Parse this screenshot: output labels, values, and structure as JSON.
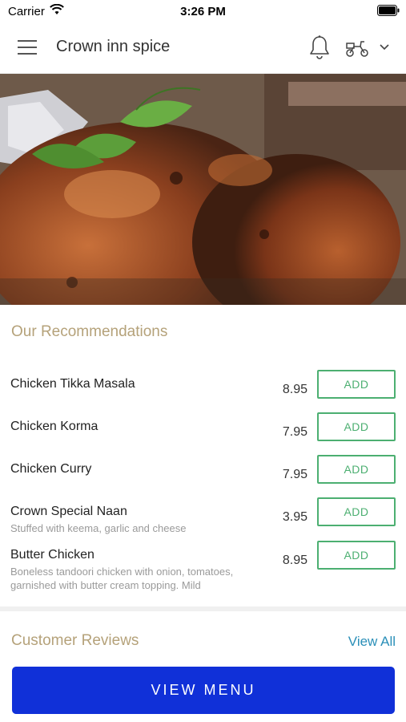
{
  "status_bar": {
    "carrier": "Carrier",
    "time": "3:26 PM"
  },
  "header": {
    "title": "Crown inn spice",
    "icons": [
      "menu-icon",
      "bell-icon",
      "scooter-icon",
      "chevron-down-icon"
    ]
  },
  "recommendations": {
    "heading": "Our Recommendations",
    "items": [
      {
        "name": "Chicken Tikka Masala",
        "description": "",
        "price": "8.95",
        "action": "ADD"
      },
      {
        "name": "Chicken Korma",
        "description": "",
        "price": "7.95",
        "action": "ADD"
      },
      {
        "name": "Chicken Curry",
        "description": "",
        "price": "7.95",
        "action": "ADD"
      },
      {
        "name": "Crown Special Naan",
        "description": "Stuffed with keema, garlic and cheese",
        "price": "3.95",
        "action": "ADD"
      },
      {
        "name": "Butter Chicken",
        "description": "Boneless tandoori chicken with onion, tomatoes, garnished with butter cream topping. Mild",
        "price": "8.95",
        "action": "ADD"
      }
    ]
  },
  "reviews": {
    "heading": "Customer Reviews",
    "view_all": "View All"
  },
  "cta": {
    "label": "VIEW MENU"
  },
  "colors": {
    "accent_heading": "#b5a27a",
    "add_button": "#4caf71",
    "link": "#2a8fb8",
    "primary_button": "#1030d8"
  }
}
